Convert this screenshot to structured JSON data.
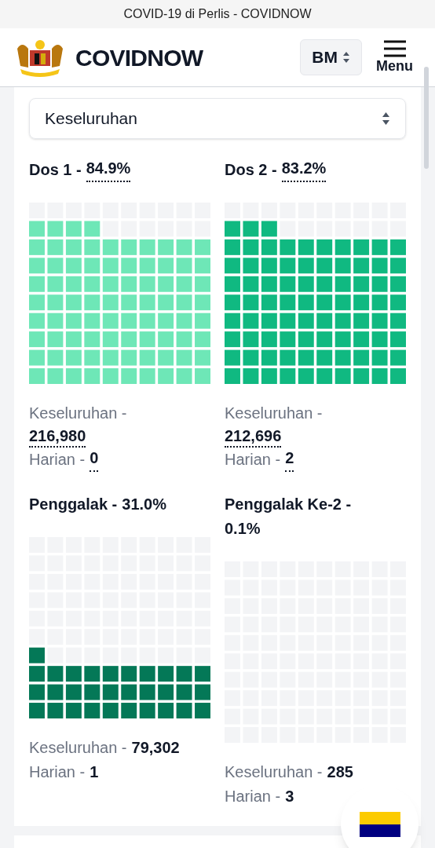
{
  "browser": {
    "title": "COVID-19 di Perlis - COVIDNOW"
  },
  "header": {
    "brand": "COVIDNOW",
    "language": "BM",
    "menu": "Menu"
  },
  "filter": {
    "value": "Keseluruhan"
  },
  "cards": [
    {
      "label": "Dos 1 -",
      "value": "84.9%",
      "dotted": true,
      "wrap": false,
      "color": "#6ee7b7",
      "stats": [
        {
          "label": "Keseluruhan -",
          "value": "216,980",
          "wrap": true
        },
        {
          "label": "Harian -",
          "value": "0",
          "wrap": false
        }
      ]
    },
    {
      "label": "Dos 2 -",
      "value": "83.2%",
      "dotted": true,
      "wrap": false,
      "color": "#10b981",
      "stats": [
        {
          "label": "Keseluruhan -",
          "value": "212,696",
          "wrap": true
        },
        {
          "label": "Harian -",
          "value": "2",
          "wrap": false
        }
      ]
    },
    {
      "label": "Penggalak -",
      "value": "31.0%",
      "dotted": false,
      "wrap": false,
      "color": "#047857",
      "stats": [
        {
          "label": "Keseluruhan -",
          "value": "79,302",
          "wrap": false
        },
        {
          "label": "Harian -",
          "value": "1",
          "wrap": false
        }
      ]
    },
    {
      "label": "Penggalak Ke-2 -",
      "value": "0.1%",
      "dotted": false,
      "wrap": true,
      "stats": [
        {
          "label": "Keseluruhan -",
          "value": "285",
          "wrap": false
        },
        {
          "label": "Harian -",
          "value": "3",
          "wrap": false
        }
      ]
    }
  ]
}
